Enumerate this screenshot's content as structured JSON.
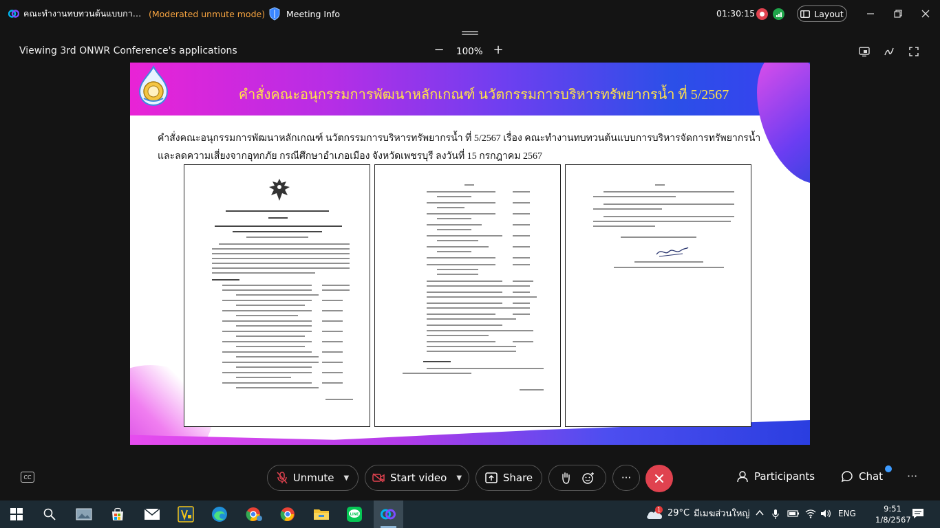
{
  "window": {
    "title": "คณะทำงานทบทวนต้นแบบการบ...",
    "moderation": "(Moderated unmute mode)",
    "meeting_info": "Meeting Info",
    "timer": "01:30:15",
    "layout_label": "Layout"
  },
  "view": {
    "viewing_label": "Viewing 3rd ONWR Conference's applications",
    "zoom_minus": "−",
    "zoom_level": "100%",
    "zoom_plus": "+"
  },
  "slide": {
    "title": "คำสั่งคณะอนุกรรมการพัฒนาหลักเกณฑ์ นวัตกรรมการบริหารทรัพยากรน้ำ ที่ 5/2567",
    "description": "คำสั่งคณะอนุกรรมการพัฒนาหลักเกณฑ์ นวัตกรรมการบริหารทรัพยากรน้ำ ที่ 5/2567 เรื่อง คณะทำงานทบทวนต้นแบบการบริหารจัดการทรัพยากรน้ำและลดความเสี่ยงจากอุทกภัย กรณีศึกษาอำเภอเมือง จังหวัดเพชรบุรี ลงวันที่ 15 กรกฎาคม 2567"
  },
  "toolbar": {
    "unmute": "Unmute",
    "start_video": "Start video",
    "share": "Share",
    "more": "···",
    "participants": "Participants",
    "chat": "Chat",
    "cc": "CC"
  },
  "taskbar": {
    "weather_badge": "1",
    "temperature": "29°C",
    "weather_text": "มีเมฆส่วนใหญ่",
    "language": "ENG",
    "time": "9:51",
    "date": "1/8/2567"
  },
  "colors": {
    "banner_title": "#ffe14a",
    "moderation": "#f7a440",
    "end_call": "#e0424f",
    "recording": "#e0424f",
    "signal": "#1fa54a"
  }
}
